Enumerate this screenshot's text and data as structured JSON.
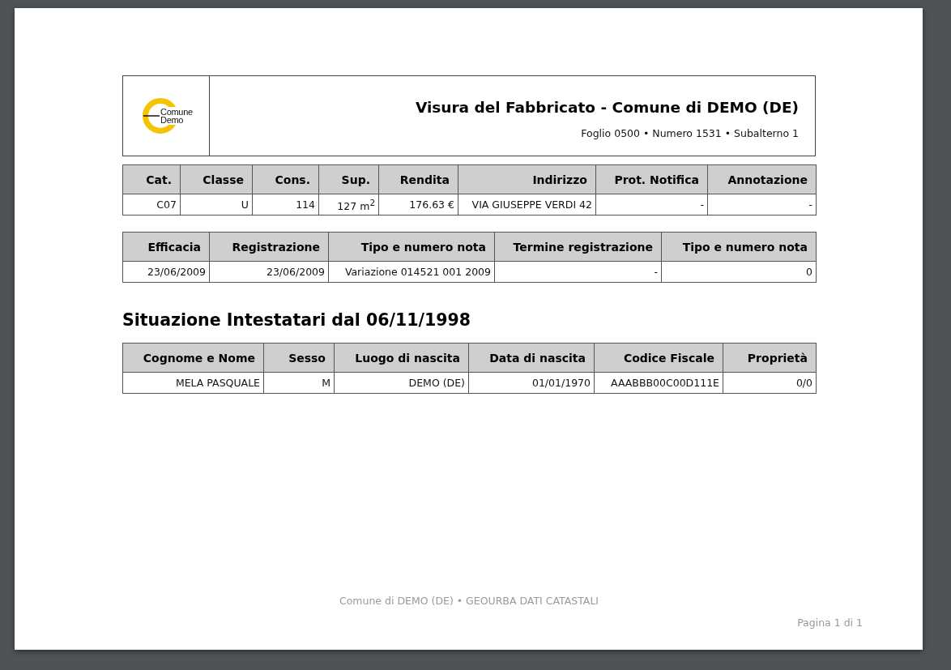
{
  "header": {
    "logo_lines": [
      "Comune",
      "Demo"
    ],
    "title": "Visura del Fabbricato - Comune di DEMO (DE)",
    "subtitle": "Foglio 0500 • Numero 1531 • Subalterno 1"
  },
  "unit_table": {
    "columns": [
      "Cat.",
      "Classe",
      "Cons.",
      "Sup.",
      "Rendita",
      "Indirizzo",
      "Prot. Notifica",
      "Annotazione"
    ],
    "rows": [
      [
        "C07",
        "U",
        "114",
        "127 m$^{2}$",
        "176.63 €",
        "VIA GIUSEPPE VERDI 42",
        "-",
        "-"
      ]
    ]
  },
  "registration_table": {
    "columns": [
      "Efficacia",
      "Registrazione",
      "Tipo e numero nota",
      "Termine registrazione",
      "Tipo e numero nota"
    ],
    "rows": [
      [
        "23/06/2009",
        "23/06/2009",
        "Variazione 014521 001 2009",
        "-",
        "0"
      ]
    ]
  },
  "owners_heading": "Situazione Intestatari dal 06/11/1998",
  "owners_table": {
    "columns": [
      "Cognome e Nome",
      "Sesso",
      "Luogo di nascita",
      "Data di nascita",
      "Codice Fiscale",
      "Proprietà"
    ],
    "rows": [
      [
        "MELA PASQUALE",
        "M",
        "DEMO (DE)",
        "01/01/1970",
        "AAABBB00C00D111E",
        "0/0"
      ]
    ]
  },
  "footer": {
    "text": "Comune di DEMO (DE) • GEOURBA DATI CATASTALI",
    "page": "Pagina 1 di 1"
  }
}
